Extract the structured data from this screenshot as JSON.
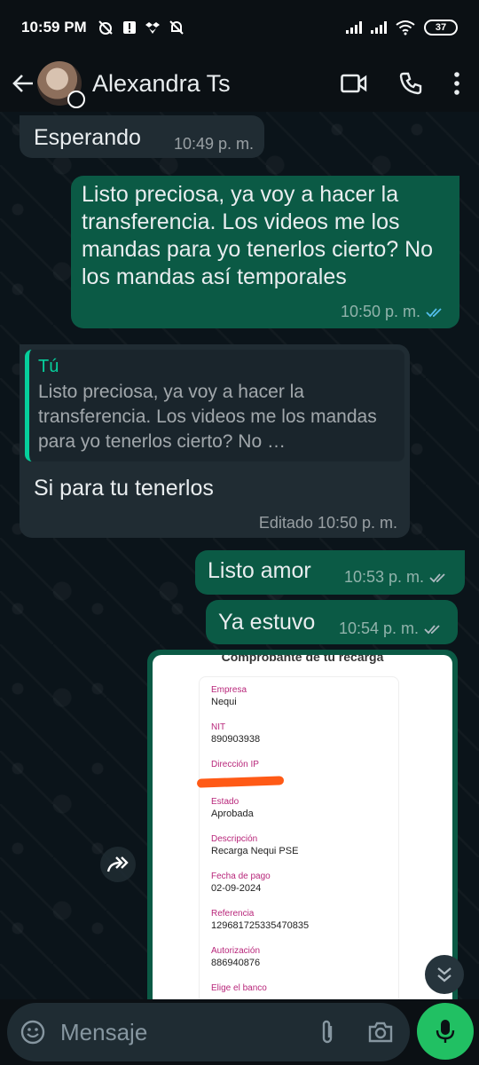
{
  "status_bar": {
    "time": "10:59 PM",
    "battery": "37"
  },
  "header": {
    "contact_name": "Alexandra Ts"
  },
  "messages": [
    {
      "direction": "in",
      "text": "Esperando",
      "time": "10:49 p. m."
    },
    {
      "direction": "out",
      "text": "Listo preciosa, ya voy a hacer la transferencia. Los videos me los mandas para yo tenerlos cierto? No los mandas así temporales",
      "time": "10:50 p. m.",
      "status": "read"
    },
    {
      "direction": "in",
      "quote_author": "Tú",
      "quote_text": "Listo preciosa, ya voy a hacer la transferencia. Los videos me los mandas para yo tenerlos cierto? No …",
      "text": "Si para tu tenerlos",
      "time": "Editado 10:50 p. m."
    },
    {
      "direction": "out",
      "text": "Listo amor",
      "time": "10:53 p. m.",
      "status": "delivered"
    },
    {
      "direction": "out",
      "text": "Ya estuvo",
      "time": "10:54 p. m.",
      "status": "delivered"
    }
  ],
  "receipt": {
    "title": "Comprobante de tu recarga",
    "fields": [
      {
        "label": "Empresa",
        "value": "Nequi"
      },
      {
        "label": "NIT",
        "value": "890903938"
      },
      {
        "label": "Dirección IP",
        "value": ""
      },
      {
        "label": "Estado",
        "value": "Aprobada"
      },
      {
        "label": "Descripción",
        "value": "Recarga Nequi PSE"
      },
      {
        "label": "Fecha de pago",
        "value": "02-09-2024"
      },
      {
        "label": "Referencia",
        "value": "129681725335470835"
      },
      {
        "label": "Autorización",
        "value": "886940876"
      },
      {
        "label": "Elige el banco",
        "value": ""
      }
    ]
  },
  "composer": {
    "placeholder": "Mensaje"
  },
  "colors": {
    "incoming": "#202c33",
    "outgoing": "#0b5a45",
    "accent": "#21c063",
    "quote_accent": "#06cf9c",
    "read_tick": "#53bdeb",
    "label_pink": "#b8267a",
    "redaction": "#ff5a16"
  },
  "icons": [
    "back-arrow-icon",
    "video-call-icon",
    "phone-icon",
    "more-vert-icon",
    "forward-icon",
    "double-chevron-down-icon",
    "emoji-icon",
    "attach-icon",
    "camera-icon",
    "mic-icon",
    "double-check-icon"
  ]
}
